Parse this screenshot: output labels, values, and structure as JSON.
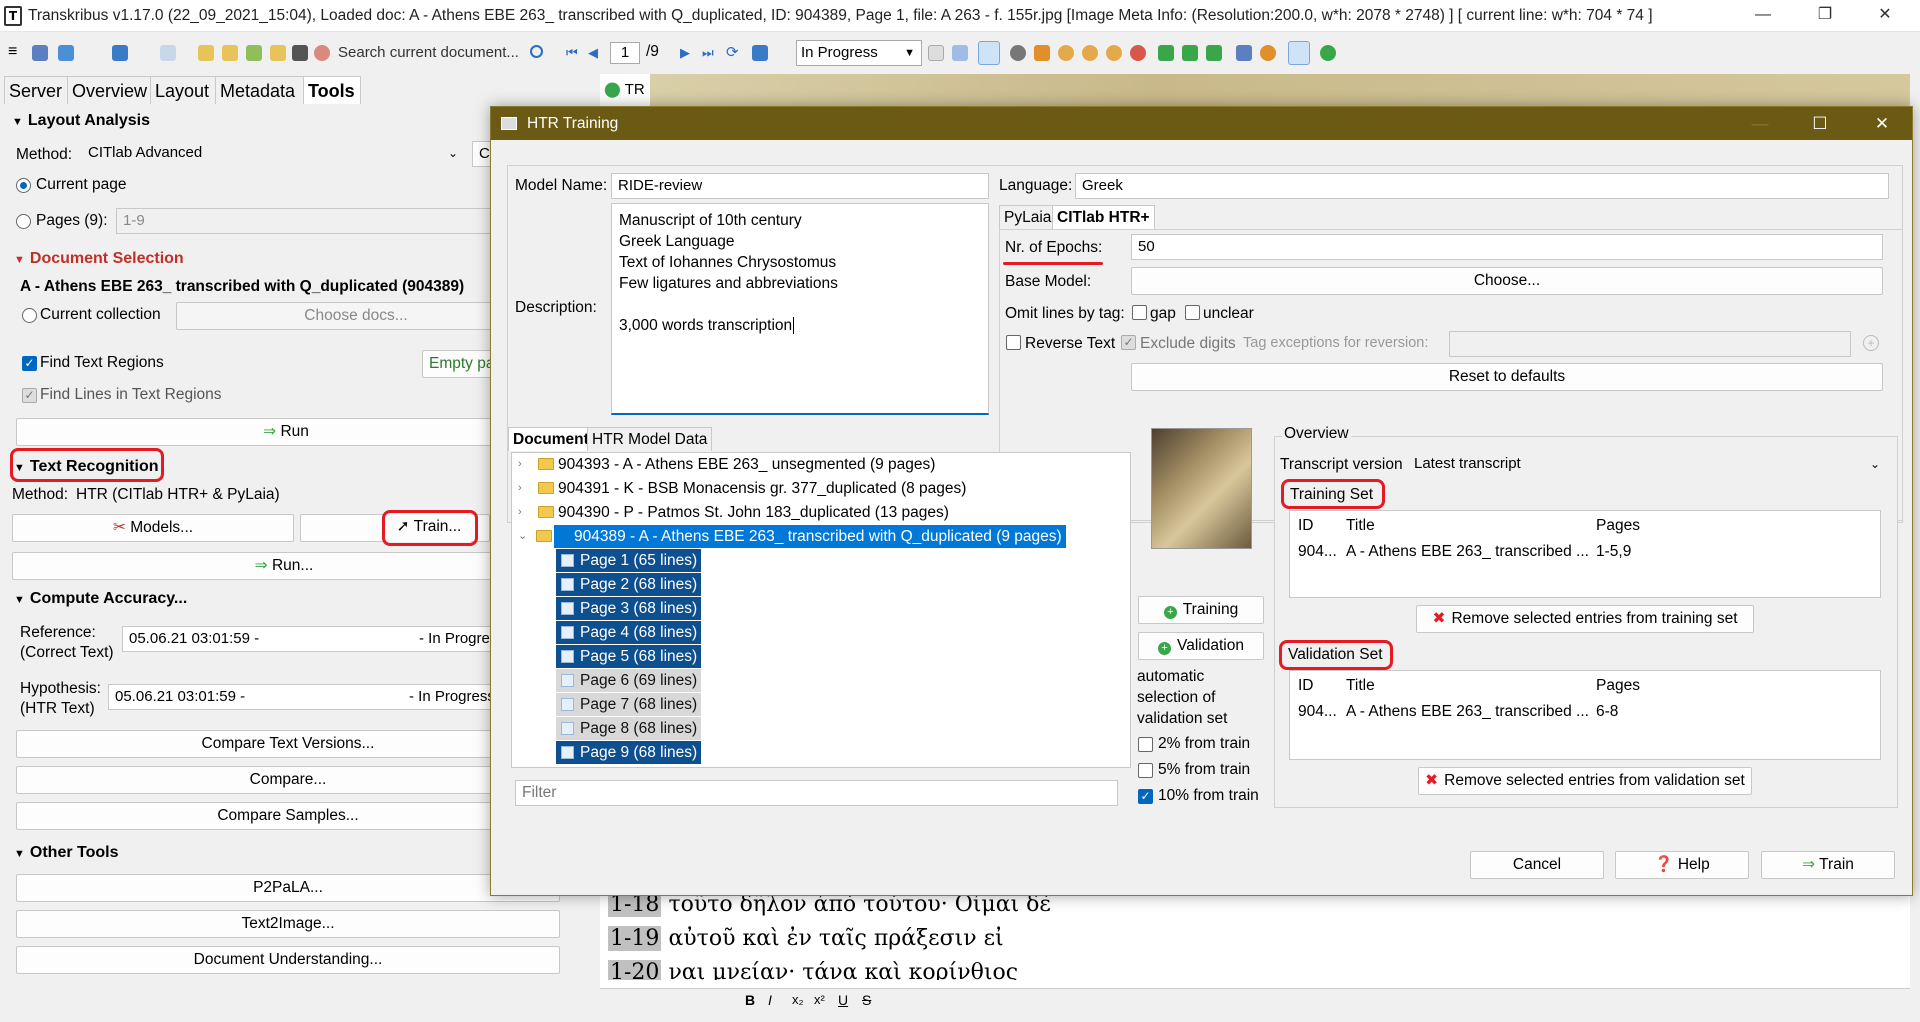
{
  "window": {
    "title": "Transkribus v1.17.0 (22_09_2021_15:04), Loaded doc: A - Athens EBE 263_ transcribed with Q_duplicated, ID: 904389, Page 1, file: A 263 - f. 155r.jpg [Image Meta Info: (Resolution:200.0, w*h: 2078 * 2748) ] [ current line: w*h: 704 * 74 ]",
    "minimize": "—",
    "maximize": "❐",
    "close": "✕"
  },
  "toolbar": {
    "search_placeholder": "Search current document...",
    "page_current": "1",
    "page_total": "/9",
    "status": "In Progress"
  },
  "left_tabs": [
    "Server",
    "Overview",
    "Layout",
    "Metadata",
    "Tools"
  ],
  "left": {
    "layout_analysis": {
      "title": "Layout Analysis",
      "method_label": "Method:",
      "method_value": "CITlab Advanced",
      "current_page": "Current page",
      "pages_label": "Pages (9):",
      "pages_value": "1-9"
    },
    "document_selection": {
      "title": "Document Selection",
      "doc_name": "A - Athens EBE 263_ transcribed with Q_duplicated (904389)",
      "current_collection": "Current collection",
      "choose_docs": "Choose docs...",
      "find_text_regions": "Find Text Regions",
      "empty_pages": "Empty pa",
      "find_lines": "Find Lines in Text Regions",
      "run": "Run"
    },
    "text_recognition": {
      "title": "Text Recognition",
      "method_label": "Method:",
      "method_value": "HTR (CITlab HTR+ & PyLaia)",
      "models": "Models...",
      "train": "Train...",
      "run": "Run..."
    },
    "compute_accuracy": {
      "title": "Compute Accuracy...",
      "reference_label": "Reference:",
      "reference_sub": "(Correct Text)",
      "reference_value": "05.06.21 03:01:59 -",
      "reference_status": "- In Progre",
      "hypothesis_label": "Hypothesis:",
      "hypothesis_sub": "(HTR Text)",
      "hypothesis_value": "05.06.21 03:01:59 -",
      "hypothesis_status": "- In Progress",
      "compare_text_versions": "Compare Text Versions...",
      "compare": "Compare...",
      "compare_samples": "Compare Samples..."
    },
    "other_tools": {
      "title": "Other Tools",
      "p2pala": "P2PaLA...",
      "text2image": "Text2Image...",
      "document_understanding": "Document Understanding..."
    }
  },
  "background": {
    "tr_tab": "TR",
    "line_18_num": "1-18",
    "line_18": "τοῦτο δῆλον ἀπὸ τούτου· Οἶμαι δὲ",
    "line_19_num": "1-19",
    "line_19": "αὐτοῦ καὶ ἐν ταῖς πράξεσιν εἰ",
    "line_20_num": "1-20",
    "line_20": "ναι μνείαν· τάνα καὶ κορίνθιος"
  },
  "dialog": {
    "title": "HTR Training",
    "model_name_label": "Model Name:",
    "model_name_value": "RIDE-review",
    "language_label": "Language:",
    "language_value": "Greek",
    "description_label": "Description:",
    "description_lines": [
      "Manuscript of 10th century",
      "Greek Language",
      "Text of Iohannes Chrysostomus",
      "Few ligatures and abbreviations",
      "",
      "3,000 words transcription"
    ],
    "engine_tabs": [
      "PyLaia",
      "CITlab HTR+"
    ],
    "epochs_label": "Nr. of Epochs:",
    "epochs_value": "50",
    "base_model_label": "Base Model:",
    "choose": "Choose...",
    "omit_label": "Omit lines by tag:",
    "gap": "gap",
    "unclear": "unclear",
    "reverse_text": "Reverse Text",
    "exclude_digits": "Exclude digits",
    "tag_exceptions": "Tag exceptions for reversion:",
    "reset": "Reset to defaults",
    "doc_tabs": [
      "Documents",
      "HTR Model Data"
    ],
    "documents": [
      "904393 - A - Athens EBE 263_ unsegmented (9 pages)",
      "904391 - K - BSB Monacensis gr. 377_duplicated (8 pages)",
      "904390 - P - Patmos St. John 183_duplicated (13 pages)",
      "904389 - A - Athens EBE 263_ transcribed with Q_duplicated (9 pages)"
    ],
    "pages": [
      {
        "label": "Page 1 (65 lines)",
        "selected": true
      },
      {
        "label": "Page 2 (68 lines)",
        "selected": true
      },
      {
        "label": "Page 3 (68 lines)",
        "selected": true
      },
      {
        "label": "Page 4 (68 lines)",
        "selected": true
      },
      {
        "label": "Page 5 (68 lines)",
        "selected": true
      },
      {
        "label": "Page 6 (69 lines)",
        "selected": false
      },
      {
        "label": "Page 7 (68 lines)",
        "selected": false
      },
      {
        "label": "Page 8 (68 lines)",
        "selected": false
      },
      {
        "label": "Page 9 (68 lines)",
        "selected": true
      }
    ],
    "filter_placeholder": "Filter",
    "training_btn": "Training",
    "validation_btn": "Validation",
    "auto_validation": [
      "automatic",
      "selection of",
      "validation set"
    ],
    "pct_2": "2% from train",
    "pct_5": "5% from train",
    "pct_10": "10% from train",
    "overview": "Overview",
    "transcript_version_label": "Transcript version",
    "transcript_version_value": "Latest transcript",
    "training_set": {
      "title": "Training Set",
      "headers": [
        "ID",
        "Title",
        "Pages"
      ],
      "row": [
        "904...",
        "A - Athens EBE 263_ transcribed ...",
        "1-5,9"
      ],
      "remove": "Remove selected entries from training set"
    },
    "validation_set": {
      "title": "Validation Set",
      "headers": [
        "ID",
        "Title",
        "Pages"
      ],
      "row": [
        "904...",
        "A - Athens EBE 263_ transcribed ...",
        "6-8"
      ],
      "remove": "Remove selected entries from validation set"
    },
    "cancel": "Cancel",
    "help": "Help",
    "train": "Train"
  }
}
